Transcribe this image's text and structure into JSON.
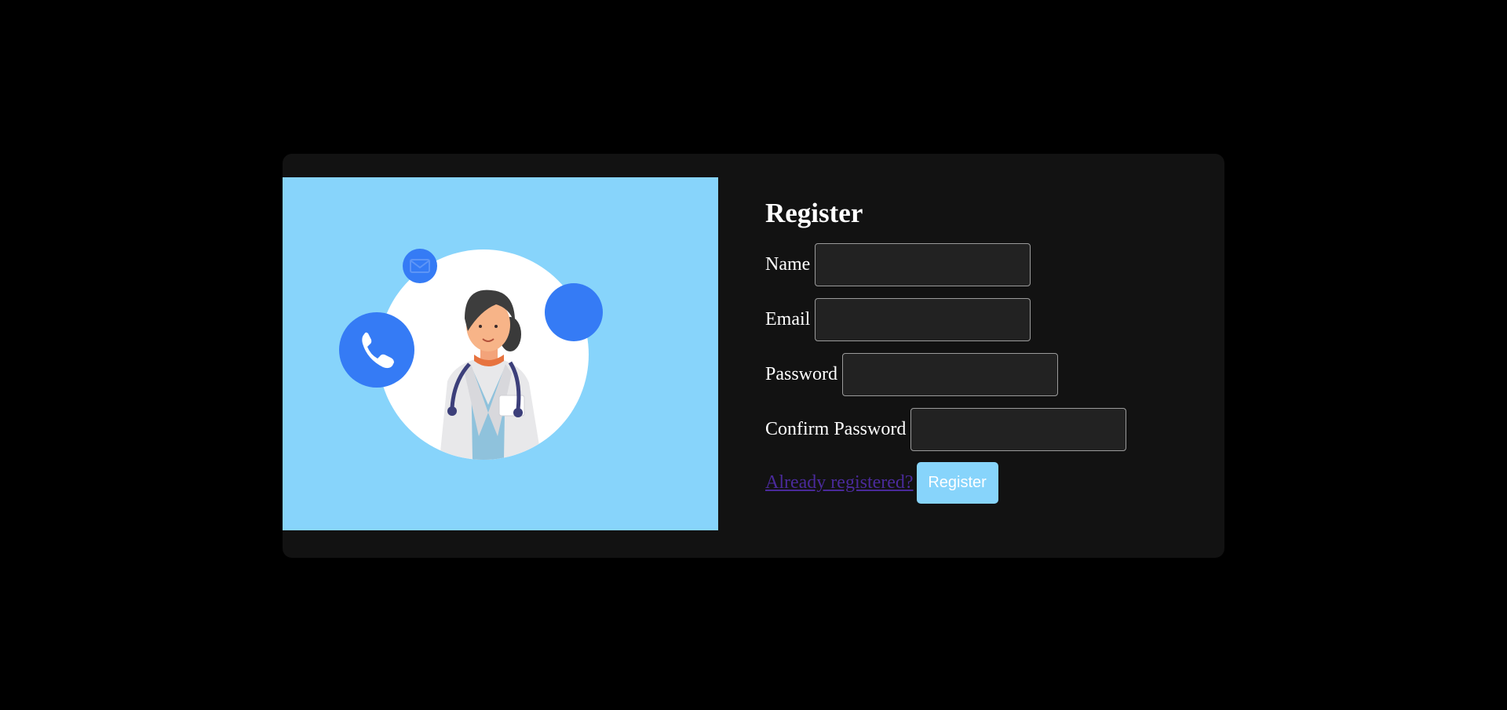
{
  "form": {
    "title": "Register",
    "fields": [
      {
        "label": "Name",
        "value": "",
        "type": "text"
      },
      {
        "label": "Email",
        "value": "",
        "type": "email"
      },
      {
        "label": "Password",
        "value": "",
        "type": "password"
      },
      {
        "label": "Confirm Password",
        "value": "",
        "type": "password"
      }
    ],
    "login_link": "Already registered?",
    "submit_label": "Register"
  },
  "illustration": {
    "subject": "doctor-illustration",
    "icons": [
      "phone-icon",
      "mail-icon"
    ]
  },
  "colors": {
    "page_bg": "#000000",
    "card_bg": "#121212",
    "illustration_bg": "#87d4fb",
    "accent_blue": "#357bf5",
    "input_bg": "#222222",
    "link": "#4a2a9b",
    "button_bg": "#87d4fb"
  }
}
